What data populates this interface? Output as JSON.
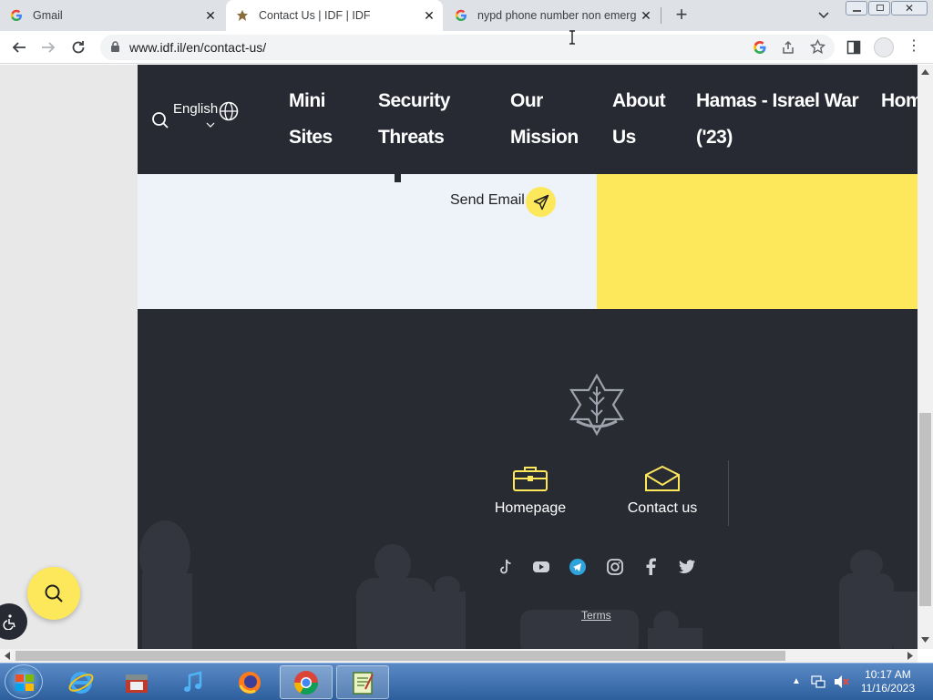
{
  "browser": {
    "tabs": [
      {
        "label": "Gmail",
        "active": false
      },
      {
        "label": "Contact Us | IDF | IDF",
        "active": true
      },
      {
        "label": "nypd phone number non emerge",
        "active": false
      }
    ],
    "new_tab": "+",
    "url": "www.idf.il/en/contact-us/"
  },
  "site": {
    "language": "English",
    "nav": [
      {
        "line1": "Mini",
        "line2": "Sites"
      },
      {
        "line1": "Security",
        "line2": "Threats"
      },
      {
        "line1": "Our",
        "line2": "Mission"
      },
      {
        "line1": "About",
        "line2": "Us"
      },
      {
        "line1": "Hamas - Israel War",
        "line2": "('23)"
      },
      {
        "line1": "Home",
        "line2": ""
      }
    ],
    "send_email": "Send Email",
    "footer": {
      "homepage": "Homepage",
      "contact": "Contact us",
      "terms": "Terms",
      "socials": [
        "tiktok-icon",
        "youtube-icon",
        "telegram-icon",
        "instagram-icon",
        "facebook-icon",
        "twitter-icon"
      ]
    },
    "colors": {
      "nav_bg": "#272a33",
      "accent": "#fde75a",
      "footer_bg": "#292b33"
    }
  },
  "taskbar": {
    "apps": [
      "windows-start",
      "internet-explorer-icon",
      "archive-icon",
      "itunes-icon",
      "firefox-icon",
      "chrome-icon",
      "notepad-icon"
    ],
    "time": "10:17 AM",
    "date": "11/16/2023"
  }
}
